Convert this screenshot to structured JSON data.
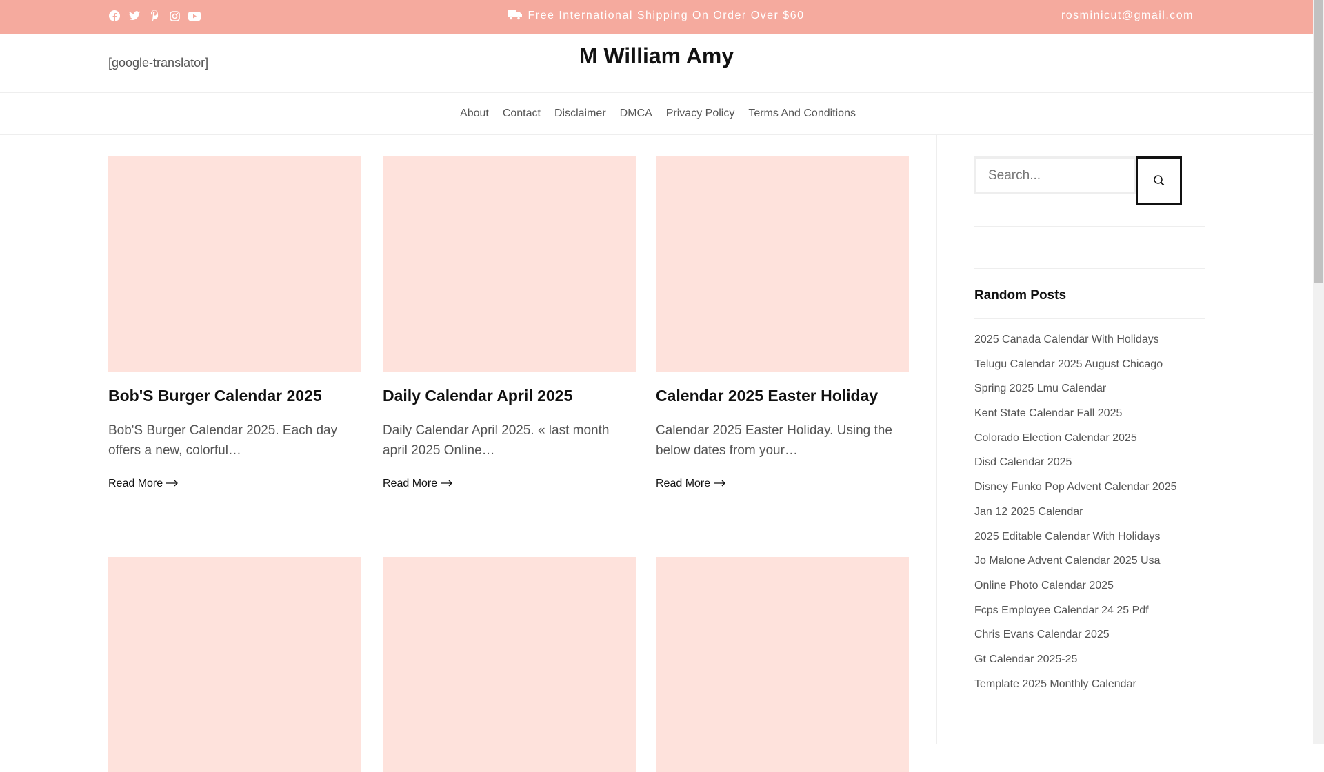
{
  "topbar": {
    "shipping": "Free International Shipping On Order Over $60",
    "email": "rosminicut@gmail.com",
    "social": [
      "facebook-icon",
      "twitter-icon",
      "pinterest-icon",
      "instagram-icon",
      "youtube-icon"
    ]
  },
  "header": {
    "translator": "[google-translator]",
    "site_title": "M William Amy"
  },
  "nav": [
    "About",
    "Contact",
    "Disclaimer",
    "DMCA",
    "Privacy Policy",
    "Terms And Conditions"
  ],
  "posts": [
    {
      "title": "Bob'S Burger Calendar 2025",
      "excerpt": "Bob'S Burger Calendar 2025. Each day offers a new, colorful…",
      "read_more": "Read More"
    },
    {
      "title": "Daily Calendar April 2025",
      "excerpt": "Daily Calendar April 2025. « last month april 2025 Online…",
      "read_more": "Read More"
    },
    {
      "title": "Calendar 2025 Easter Holiday",
      "excerpt": "Calendar 2025 Easter Holiday. Using the below dates from your…",
      "read_more": "Read More"
    }
  ],
  "sidebar": {
    "search_placeholder": "Search...",
    "random_title": "Random Posts",
    "random_posts": [
      "2025 Canada Calendar With Holidays",
      "Telugu Calendar 2025 August Chicago",
      "Spring 2025 Lmu Calendar",
      "Kent State Calendar Fall 2025",
      "Colorado Election Calendar 2025",
      "Disd Calendar 2025",
      "Disney Funko Pop Advent Calendar 2025",
      "Jan 12 2025 Calendar",
      "2025 Editable Calendar With Holidays",
      "Jo Malone Advent Calendar 2025 Usa",
      "Online Photo Calendar 2025",
      "Fcps Employee Calendar 24 25 Pdf",
      "Chris Evans Calendar 2025",
      "Gt Calendar 2025-25",
      "Template 2025 Monthly Calendar"
    ]
  }
}
